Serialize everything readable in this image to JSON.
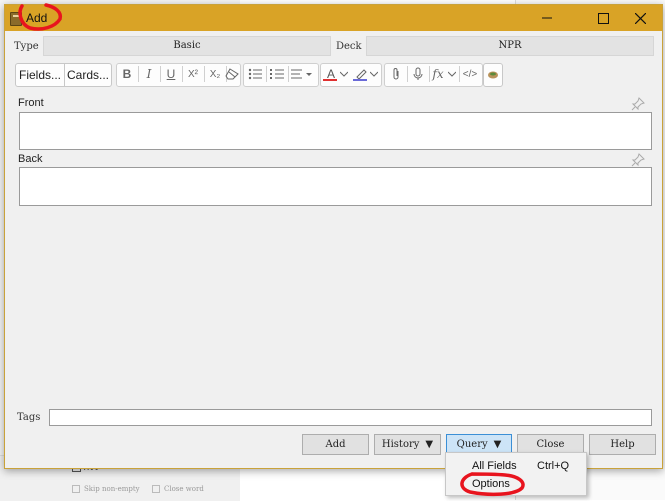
{
  "window": {
    "title": "Add"
  },
  "type_row": {
    "type_label": "Type",
    "type_value": "Basic",
    "deck_label": "Deck",
    "deck_value": "NPR"
  },
  "toolbar": {
    "fields_label": "Fields...",
    "cards_label": "Cards...",
    "bold": "B",
    "italic": "I",
    "underline": "U",
    "superscript": "X²",
    "subscript": "X₂",
    "text_color_glyph": "A",
    "formula_glyph": "fx",
    "html_glyph": "</>",
    "text_color_accent": "#e03030",
    "highlight_accent": "#6a6ad8"
  },
  "fields": [
    {
      "label": "Front",
      "value": ""
    },
    {
      "label": "Back",
      "value": ""
    }
  ],
  "tags": {
    "label": "Tags",
    "value": ""
  },
  "buttons": {
    "add": "Add",
    "history": "History",
    "query": "Query",
    "close": "Close",
    "help": "Help"
  },
  "query_menu": {
    "items": [
      {
        "label": "All Fields",
        "shortcut": "Ctrl+Q"
      },
      {
        "label": "Options",
        "shortcut": ""
      }
    ]
  },
  "background": {
    "all_label": "All",
    "skip_label": "Skip non-empty",
    "close_word_label": "Close word"
  },
  "annotation_color": "#e8141e"
}
